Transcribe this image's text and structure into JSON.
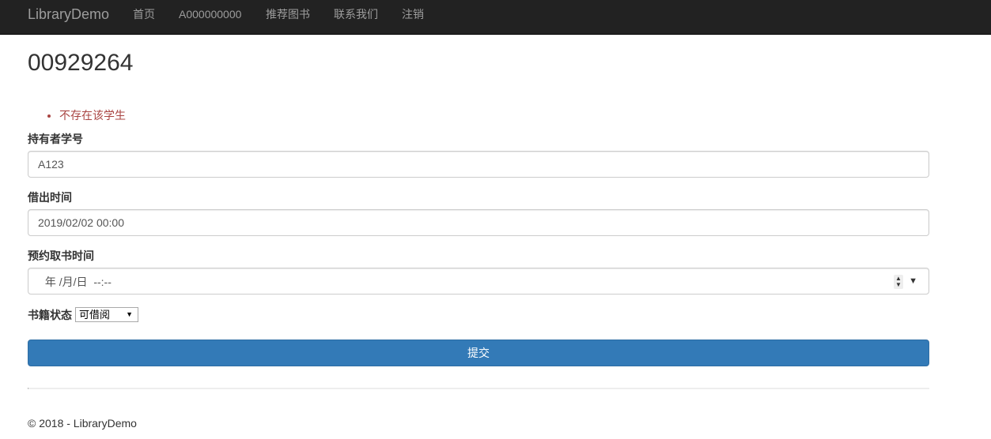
{
  "navbar": {
    "brand": "LibraryDemo",
    "items": [
      {
        "label": "首页"
      },
      {
        "label": "A000000000"
      },
      {
        "label": "推荐图书"
      },
      {
        "label": "联系我们"
      },
      {
        "label": "注销"
      }
    ]
  },
  "page": {
    "title": "00929264"
  },
  "validation": {
    "errors": [
      "不存在该学生"
    ]
  },
  "form": {
    "holder_id": {
      "label": "持有者学号",
      "value": "A123"
    },
    "borrow_time": {
      "label": "借出时间",
      "value": "2019/02/02 00:00"
    },
    "reserve_time": {
      "label": "预约取书时间",
      "value": " 年 /月/日  --:--"
    },
    "status": {
      "label": "书籍状态",
      "selected": "可借阅"
    },
    "submit_label": "提交"
  },
  "footer": {
    "text": "© 2018 - LibraryDemo"
  },
  "colors": {
    "navbar_bg": "#222222",
    "nav_text": "#9d9d9d",
    "primary": "#337ab7",
    "error_text": "#a94442"
  }
}
